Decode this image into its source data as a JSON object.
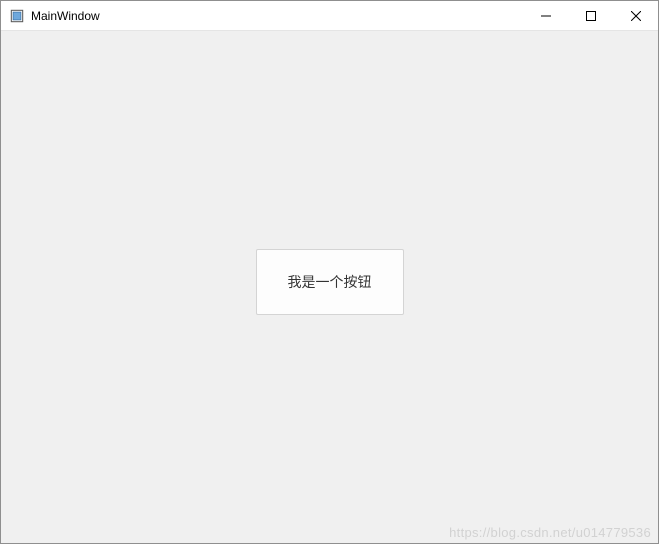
{
  "window": {
    "title": "MainWindow"
  },
  "main": {
    "button_label": "我是一个按钮"
  },
  "watermark": "https://blog.csdn.net/u014779536"
}
